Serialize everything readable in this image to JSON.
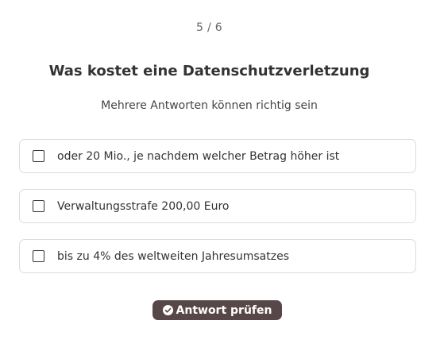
{
  "quiz": {
    "progress": "5 / 6",
    "question": "Was kostet eine Datenschutzverletzung",
    "hint": "Mehrere Antworten können richtig sein",
    "options": [
      {
        "label": "oder 20 Mio., je nachdem welcher Betrag höher ist",
        "checked": false
      },
      {
        "label": "Verwaltungsstrafe 200,00 Euro",
        "checked": false
      },
      {
        "label": "bis zu 4% des weltweiten Jahresumsatzes",
        "checked": false
      }
    ],
    "submit_label": "Antwort prüfen",
    "submit_icon": "check-circle-icon"
  },
  "colors": {
    "button_bg": "#584748",
    "border": "#dcdcdc",
    "text": "#333333"
  }
}
